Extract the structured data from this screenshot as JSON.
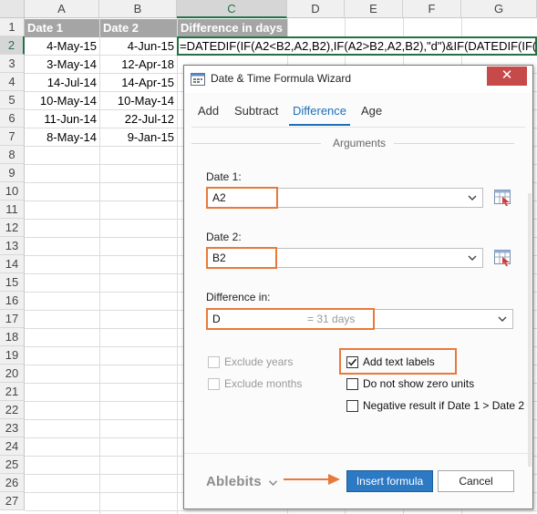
{
  "spreadsheet": {
    "columns": [
      "A",
      "B",
      "C",
      "D",
      "E",
      "F",
      "G"
    ],
    "rows": [
      "1",
      "2",
      "3",
      "4",
      "5",
      "6",
      "7",
      "8",
      "9",
      "10",
      "11",
      "12",
      "13",
      "14",
      "15",
      "16",
      "17",
      "18",
      "19",
      "20",
      "21",
      "22",
      "23",
      "24",
      "25",
      "26",
      "27"
    ],
    "headers": {
      "a": "Date 1",
      "b": "Date 2",
      "c": "Difference in days"
    },
    "data": [
      {
        "a": "4-May-15",
        "b": "4-Jun-15"
      },
      {
        "a": "3-May-14",
        "b": "12-Apr-18"
      },
      {
        "a": "14-Jul-14",
        "b": "14-Apr-15"
      },
      {
        "a": "10-May-14",
        "b": "10-May-14"
      },
      {
        "a": "11-Jun-14",
        "b": "22-Jul-12"
      },
      {
        "a": "8-May-14",
        "b": "9-Jan-15"
      }
    ],
    "formula": "=DATEDIF(IF(A2<B2,A2,B2),IF(A2>B2,A2,B2),\"d\")&IF(DATEDIF(IF(A"
  },
  "dialog": {
    "title": "Date & Time Formula Wizard",
    "close_glyph": "✕",
    "tabs": [
      "Add",
      "Subtract",
      "Difference",
      "Age"
    ],
    "active_tab": "Difference",
    "arguments_label": "Arguments",
    "date1": {
      "label": "Date 1:",
      "value": "A2"
    },
    "date2": {
      "label": "Date 2:",
      "value": "B2"
    },
    "difference_in": {
      "label": "Difference in:",
      "value": "D",
      "hint": "= 31 days"
    },
    "checkboxes": {
      "exclude_years": {
        "label": "Exclude years",
        "checked": false,
        "enabled": false
      },
      "exclude_months": {
        "label": "Exclude months",
        "checked": false,
        "enabled": false
      },
      "add_text_labels": {
        "label": "Add text labels",
        "checked": true
      },
      "no_zero_units": {
        "label": "Do not show zero units",
        "checked": false
      },
      "negative_result": {
        "label": "Negative result if Date 1 > Date 2",
        "checked": false
      }
    },
    "brand": "Ablebits",
    "insert_label": "Insert formula",
    "cancel_label": "Cancel",
    "accent_color": "#2c79c4",
    "highlight_color": "#e8793a"
  }
}
